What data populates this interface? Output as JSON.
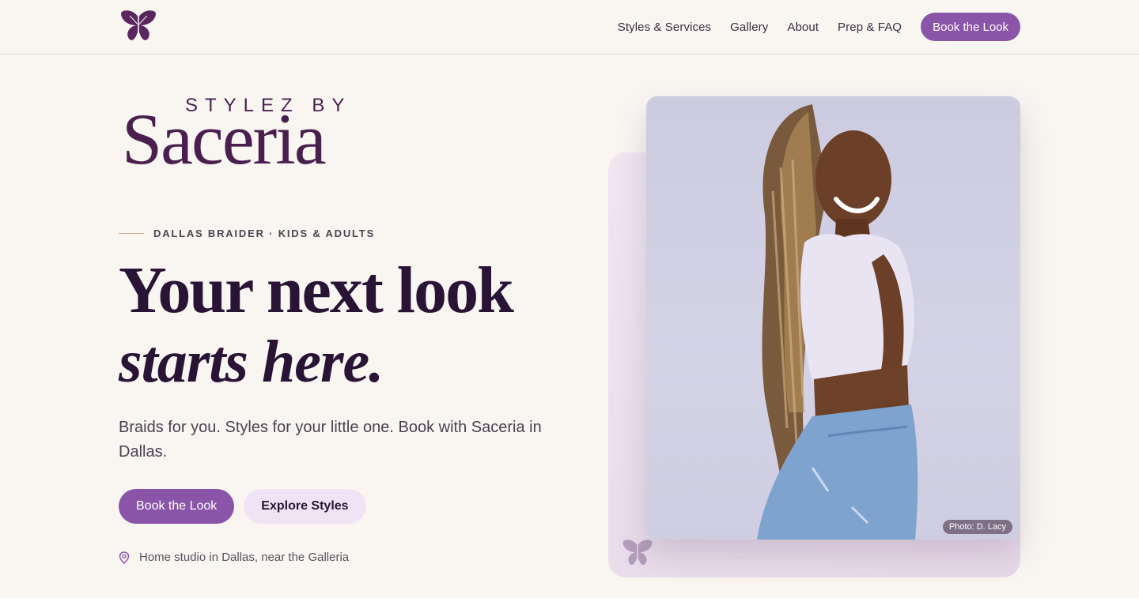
{
  "nav": {
    "links": [
      "Styles & Services",
      "Gallery",
      "About",
      "Prep & FAQ"
    ],
    "cta": "Book the Look",
    "logo_icon": "butterfly-icon"
  },
  "hero": {
    "brand_top": "STYLEZ BY",
    "brand_script": "Saceria",
    "eyebrow": "DALLAS BRAIDER · KIDS & ADULTS",
    "headline_line1": "Your next look",
    "headline_line2": "starts here.",
    "lede": "Braids for you. Styles for your little one. Book with Saceria in Dallas.",
    "primary_cta": "Book the Look",
    "secondary_cta": "Explore Styles",
    "location_icon": "map-pin-icon",
    "location": "Home studio in Dallas, near the Galleria"
  },
  "photo": {
    "credit": "Photo: D. Lacy"
  },
  "colors": {
    "accent": "#8a55a8",
    "brand": "#4a1f4e",
    "background": "#f9f6f2",
    "soft_accent": "#efe4f3"
  }
}
